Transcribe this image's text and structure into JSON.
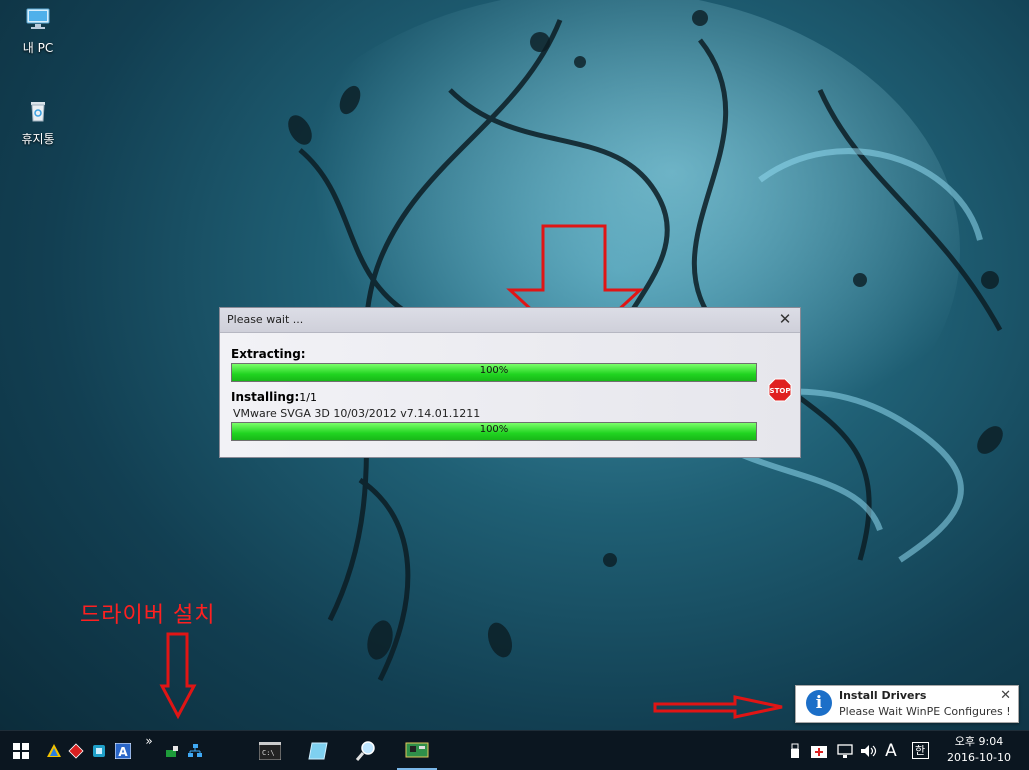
{
  "desktop": {
    "icons": [
      {
        "label": "내 PC",
        "icon": "computer-icon"
      },
      {
        "label": "휴지통",
        "icon": "recycle-bin-icon"
      }
    ]
  },
  "dialog": {
    "title": "Please wait ...",
    "close_glyph": "✕",
    "extracting_label": "Extracting:",
    "extract_progress": {
      "percent": 100,
      "text": "100%"
    },
    "installing_label": "Installing:",
    "installing_count": "1/1",
    "driver_line": "VMware SVGA 3D  10/03/2012 v7.14.01.1211",
    "install_progress": {
      "percent": 100,
      "text": "100%"
    },
    "stop_label": "STOP"
  },
  "annotation": {
    "text": "드라이버 설치",
    "color": "#ff2020"
  },
  "toast": {
    "title": "Install Drivers",
    "message": "Please Wait WinPE Configures !...",
    "close_glyph": "✕",
    "icon": "info-icon"
  },
  "taskbar": {
    "start_icon": "windows-start-icon",
    "quicklaunch": [
      "triangle-app-icon",
      "red-diamond-app-icon",
      "cube-app-icon",
      "font-a-app-icon"
    ],
    "overflow_glyph": "»",
    "pinned": [
      "cmd-icon",
      "notepad-icon",
      "search-magnifier-icon",
      "driver-board-icon"
    ],
    "tray": {
      "items": [
        "usb-icon",
        "first-aid-icon",
        "network-icon",
        "volume-icon"
      ],
      "ime_letter": "A",
      "lang": "한",
      "time": "오후 9:04",
      "date": "2016-10-10"
    }
  },
  "colors": {
    "progress_green": "#21d421",
    "accent_blue": "#1c6fc8",
    "annotation_red": "#ff2020"
  }
}
